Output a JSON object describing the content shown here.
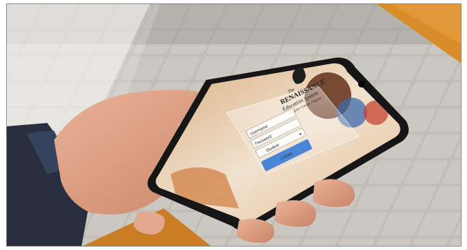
{
  "scene": {
    "description_colors": {
      "pavement": "#bdbab4",
      "wood": "#d98c2a",
      "skin": "#e2a487",
      "sleeve": "#2f3a58",
      "phone_body": "#1a1a1a",
      "login_button": "#4a86d8",
      "frame_border": "#8a8a8a"
    }
  },
  "app": {
    "logo_line1": "The",
    "logo_line2": "RENAISSANCE",
    "logo_line3": "Education System",
    "logo_tagline": "Imagine • Create • Inspire",
    "username_placeholder": "Username",
    "password_placeholder": "Password",
    "role_label": "Student",
    "login_label": "LOGIN"
  }
}
